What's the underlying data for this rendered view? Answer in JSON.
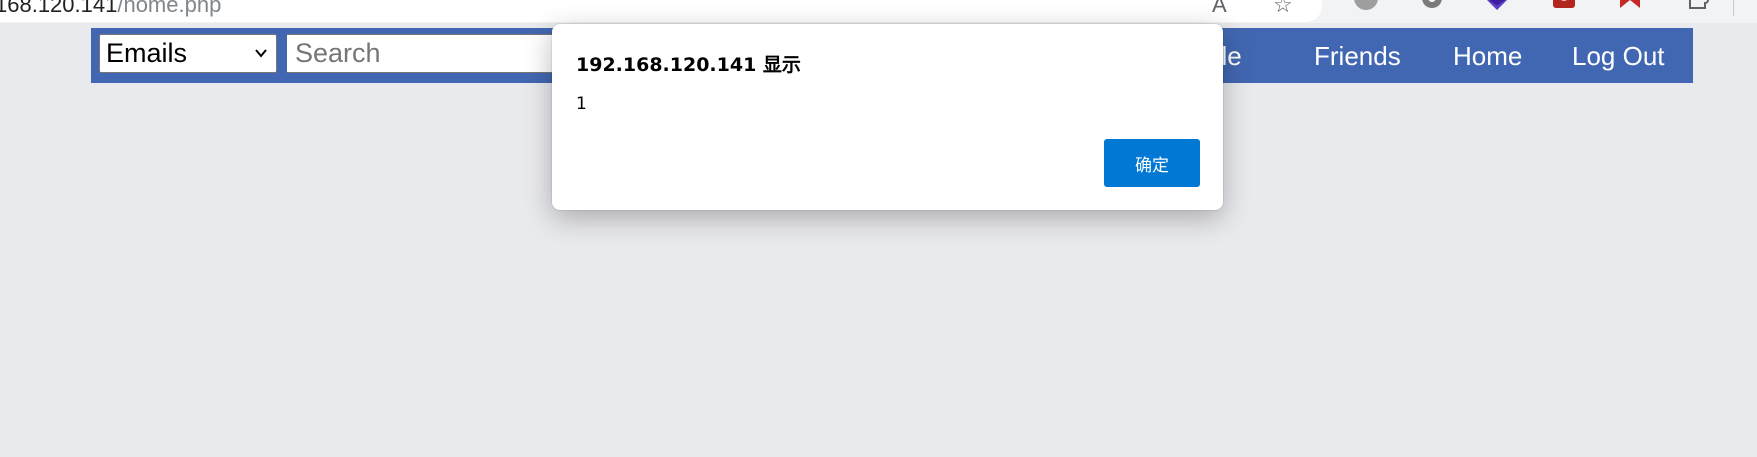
{
  "browser": {
    "url_host": "168.120.141",
    "url_path": "/home.php",
    "icons": [
      "read-aloud-icon",
      "favorite-star-icon",
      "profile-circle-icon",
      "extension-gear-icon",
      "extension-diamond-icon",
      "extension-red-icon",
      "extension-ribbon-icon",
      "extensions-puzzle-icon"
    ]
  },
  "navbar": {
    "category_select": {
      "value": "Emails"
    },
    "search": {
      "placeholder": "Search",
      "value": ""
    },
    "links": {
      "profile": "ofile",
      "friends": "Friends",
      "home": "Home",
      "logout": "Log Out"
    },
    "color": "#4267b2"
  },
  "alert": {
    "title": "192.168.120.141 显示",
    "message": "1",
    "ok_label": "确定",
    "ok_color": "#0078d4"
  },
  "page": {
    "background": "#e9eaee"
  }
}
